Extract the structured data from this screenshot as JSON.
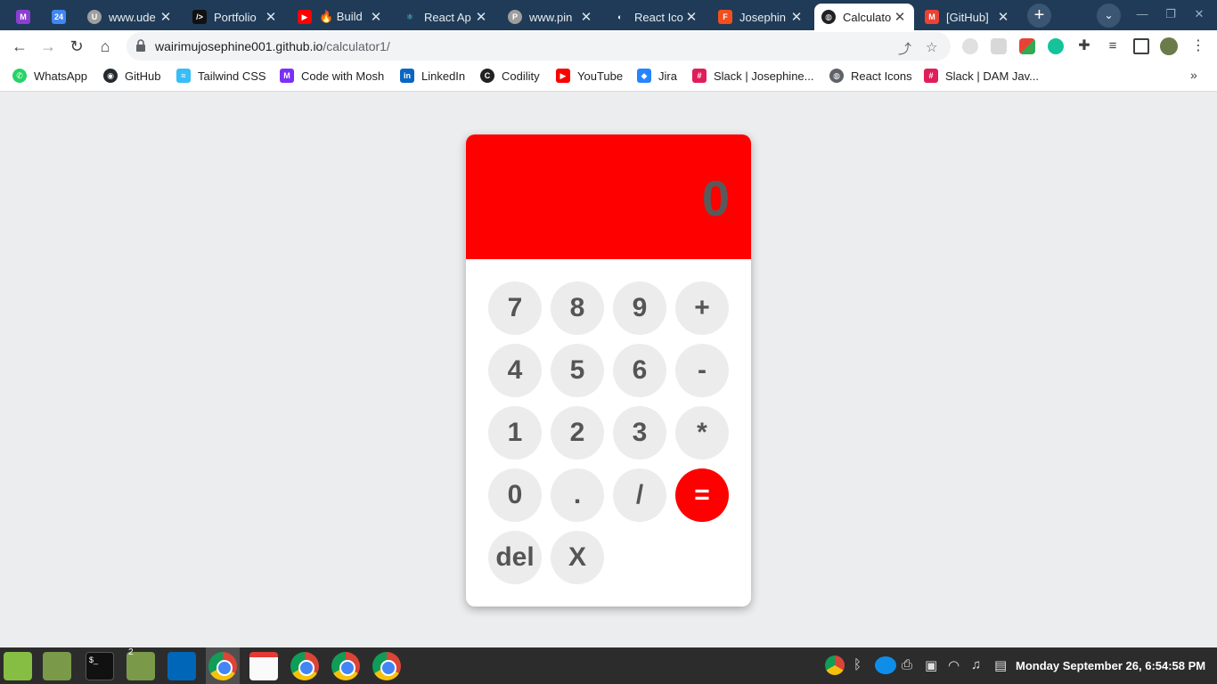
{
  "browser": {
    "tabs": [
      {
        "title": "",
        "favicon_color": "#8b3fd1",
        "favicon_text": "M"
      },
      {
        "title": "",
        "favicon_color": "#4285f4",
        "favicon_text": "24"
      },
      {
        "title": "www.ude",
        "favicon_color": "#9e9e9e",
        "favicon_text": "U"
      },
      {
        "title": "Portfolio",
        "favicon_color": "#111111",
        "favicon_text": "/>"
      },
      {
        "title": "🔥 Build",
        "favicon_color": "#ff0000",
        "favicon_text": "▶"
      },
      {
        "title": "React Ap",
        "favicon_color": "#1f3b57",
        "favicon_text": "⚛"
      },
      {
        "title": "www.pin",
        "favicon_color": "#9e9e9e",
        "favicon_text": "P"
      },
      {
        "title": "React Ico",
        "favicon_color": "#1f3b57",
        "favicon_text": "◐"
      },
      {
        "title": "Josephin",
        "favicon_color": "#f24e1e",
        "favicon_text": "F"
      },
      {
        "title": "Calculato",
        "favicon_color": "#202124",
        "favicon_text": "◍"
      },
      {
        "title": "[GitHub]",
        "favicon_color": "#ea4335",
        "favicon_text": "M"
      }
    ],
    "new_tab": "+",
    "url_host": "wairimujosephine001.github.io",
    "url_path": "/calculator1/"
  },
  "bookmarks": [
    {
      "label": "WhatsApp",
      "color": "#25d366",
      "glyph": "✆"
    },
    {
      "label": "GitHub",
      "color": "#24292e",
      "glyph": "◉"
    },
    {
      "label": "Tailwind CSS",
      "color": "#38bdf8",
      "glyph": "≈"
    },
    {
      "label": "Code with Mosh",
      "color": "#7b2ff7",
      "glyph": "M"
    },
    {
      "label": "LinkedIn",
      "color": "#0a66c2",
      "glyph": "in"
    },
    {
      "label": "Codility",
      "color": "#222222",
      "glyph": "C"
    },
    {
      "label": "YouTube",
      "color": "#ff0000",
      "glyph": "▶"
    },
    {
      "label": "Jira",
      "color": "#2684ff",
      "glyph": "◆"
    },
    {
      "label": "Slack | Josephine...",
      "color": "#e01e5a",
      "glyph": "#"
    },
    {
      "label": "React Icons",
      "color": "#5f6368",
      "glyph": "◍"
    },
    {
      "label": "Slack | DAM Jav...",
      "color": "#e01e5a",
      "glyph": "#"
    }
  ],
  "calculator": {
    "display": "0",
    "keys": [
      "7",
      "8",
      "9",
      "+",
      "4",
      "5",
      "6",
      "-",
      "1",
      "2",
      "3",
      "*",
      "0",
      ".",
      "/",
      "=",
      "del",
      "X"
    ],
    "accent_color": "#ff0000"
  },
  "taskbar": {
    "clock": "Monday September 26, 6:54:58 PM",
    "workspace_badge": "2"
  }
}
